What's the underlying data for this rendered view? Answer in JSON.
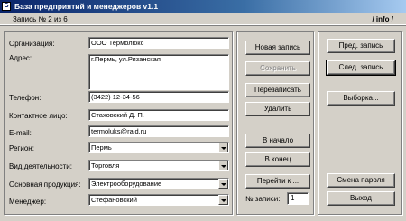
{
  "window": {
    "title": "База предприятий и менеджеров v1.1",
    "icon_glyph": "Б"
  },
  "status": {
    "record": "Запись № 2 из 6",
    "info": "/ info /"
  },
  "form": {
    "org_label": "Организация:",
    "org_value": "ООО Термолюкс",
    "address_label": "Адрес:",
    "address_value": "г.Пермь, ул.Рязанская",
    "phone_label": "Телефон:",
    "phone_value": "(3422) 12-34-56",
    "contact_label": "Контактное лицо:",
    "contact_value": "Стаховский Д. П.",
    "email_label": "E-mail:",
    "email_value": "termoluks@raid.ru",
    "region_label": "Регион:",
    "region_value": "Пермь",
    "activity_label": "Вид деятельности:",
    "activity_value": "Торговля",
    "product_label": "Основная продукция:",
    "product_value": "Электрооборудование",
    "manager_label": "Менеджер:",
    "manager_value": "Стефановский"
  },
  "buttons": {
    "new_record": "Новая запись",
    "save": "Сохранить",
    "rewrite": "Перезаписать",
    "delete": "Удалить",
    "to_start": "В начало",
    "to_end": "В конец",
    "goto": "Перейти к ...",
    "prev": "Пред. запись",
    "next": "След. запись",
    "select": "Выборка...",
    "change_password": "Смена пароля",
    "exit": "Выход"
  },
  "goto_record": {
    "label": "№ записи:",
    "value": "1"
  }
}
